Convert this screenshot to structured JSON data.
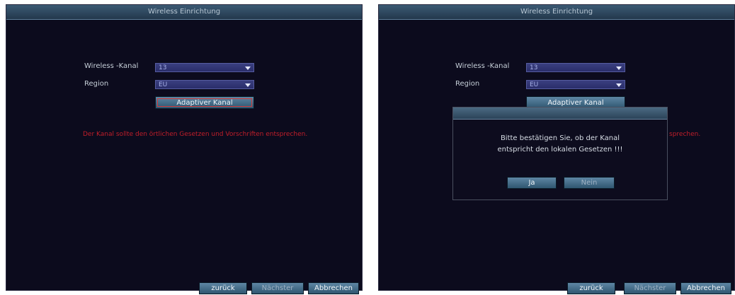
{
  "left": {
    "title": "Wireless Einrichtung",
    "channel_label": "Wireless -Kanal",
    "channel_value": "13",
    "region_label": "Region",
    "region_value": "EU",
    "adaptive_button": "Adaptiver Kanal",
    "warning": "Der Kanal sollte den örtlichen Gesetzen und Vorschriften entsprechen.",
    "back_button": "zurück",
    "next_button": "Nächster",
    "cancel_button": "Abbrechen"
  },
  "right": {
    "title": "Wireless Einrichtung",
    "channel_label": "Wireless -Kanal",
    "channel_value": "13",
    "region_label": "Region",
    "region_value": "EU",
    "adaptive_button": "Adaptiver Kanal",
    "warning_partial": "sprechen.",
    "dialog": {
      "message_line1": "Bitte bestätigen Sie, ob der Kanal",
      "message_line2": "entspricht den lokalen Gesetzen !!!",
      "yes_button": "Ja",
      "no_button": "Nein"
    },
    "back_button": "zurück",
    "next_button": "Nächster",
    "cancel_button": "Abbrechen"
  },
  "colors": {
    "background": "#0c0b1d",
    "title_bar": "#3c5a74",
    "warning_text": "#c21e2a",
    "button": "#4a7090",
    "focus_outline": "#d23c3c"
  }
}
